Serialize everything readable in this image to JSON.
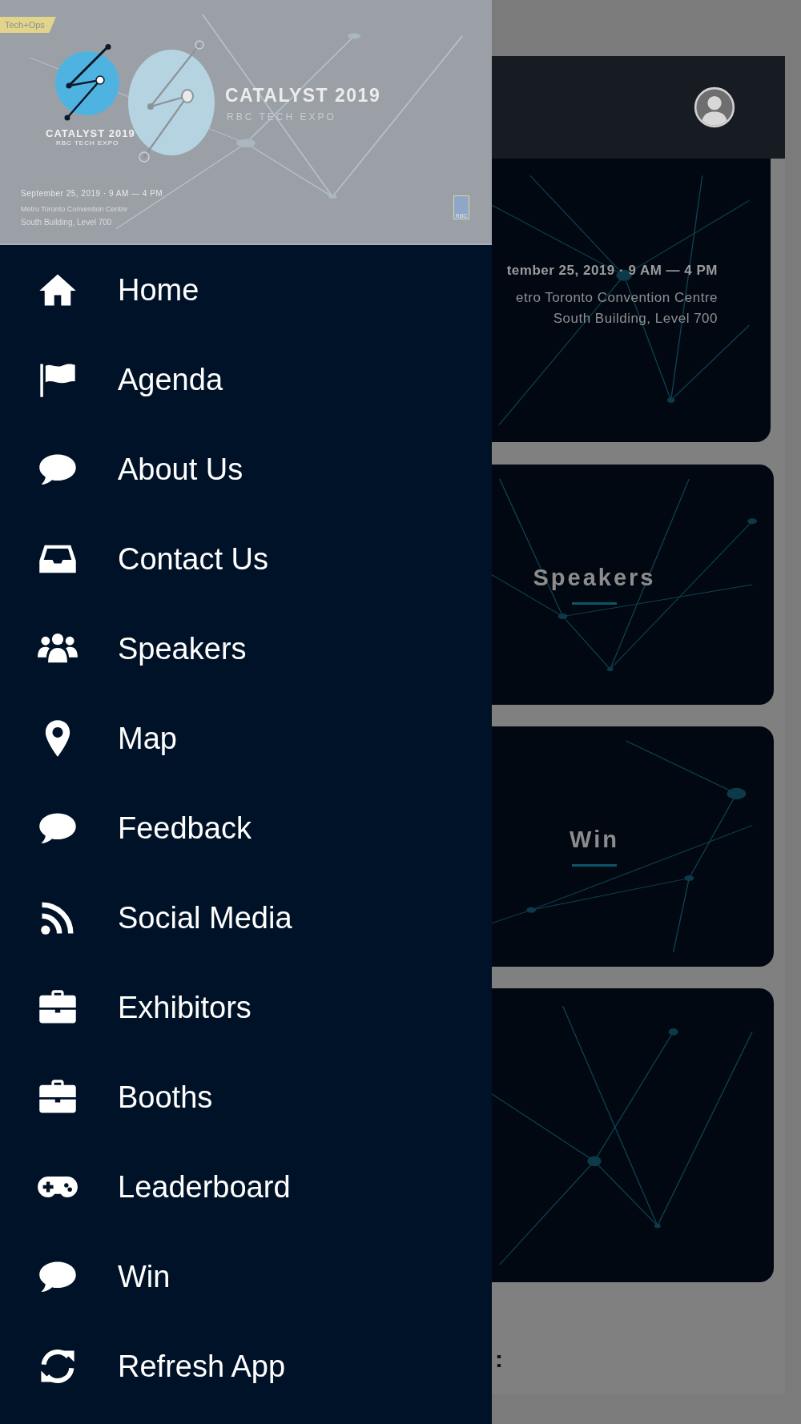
{
  "drawer": {
    "banner": {
      "tag": "Tech+Ops",
      "logo_title": "CATALYST 2019",
      "logo_subtitle": "RBC TECH EXPO",
      "title": "CATALYST 2019",
      "subtitle": "RBC TECH EXPO",
      "date_line": "September 25, 2019 · 9 AM — 4 PM",
      "venue_lines": [
        "Metro Toronto Convention Centre",
        "South Building, Level 700"
      ],
      "sponsor": "RBC"
    },
    "menu": [
      {
        "label": "Home",
        "kind": "home"
      },
      {
        "label": "Agenda",
        "kind": "flag"
      },
      {
        "label": "About Us",
        "kind": "chat"
      },
      {
        "label": "Contact Us",
        "kind": "inbox"
      },
      {
        "label": "Speakers",
        "kind": "users"
      },
      {
        "label": "Map",
        "kind": "pin"
      },
      {
        "label": "Feedback",
        "kind": "chat"
      },
      {
        "label": "Social Media",
        "kind": "rss"
      },
      {
        "label": "Exhibitors",
        "kind": "briefcase"
      },
      {
        "label": "Booths",
        "kind": "briefcase"
      },
      {
        "label": "Leaderboard",
        "kind": "gamepad"
      },
      {
        "label": "Win",
        "kind": "chat"
      },
      {
        "label": "Refresh App",
        "kind": "refresh"
      }
    ]
  },
  "page": {
    "event_card": {
      "date_line": "tember 25, 2019 · 9 AM — 4 PM",
      "venue_lines": [
        "etro Toronto Convention Centre",
        "South Building, Level 700"
      ]
    },
    "tiles": [
      {
        "kind": "titled",
        "title": "Speakers"
      },
      {
        "kind": "titled",
        "title": "Win"
      },
      {
        "kind": "plain"
      }
    ],
    "footer_text": ":"
  }
}
